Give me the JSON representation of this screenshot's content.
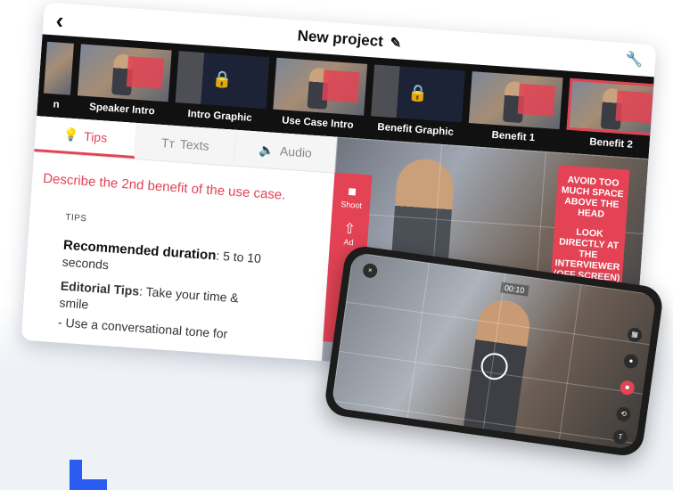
{
  "app": {
    "title": "New project",
    "back_icon": "chevron-left-icon",
    "edit_icon": "pencil-icon",
    "settings_icon": "wrench-icon"
  },
  "strip": {
    "items": [
      {
        "label": "n",
        "type": "video"
      },
      {
        "label": "Speaker Intro",
        "type": "video"
      },
      {
        "label": "Intro Graphic",
        "type": "graphic"
      },
      {
        "label": "Use Case Intro",
        "type": "video"
      },
      {
        "label": "Benefit Graphic",
        "type": "graphic"
      },
      {
        "label": "Benefit 1",
        "type": "video"
      },
      {
        "label": "Benefit 2",
        "type": "video",
        "active": true
      }
    ]
  },
  "tabs": [
    {
      "label": "Tips",
      "active": true
    },
    {
      "label": "Texts"
    },
    {
      "label": "Audio"
    }
  ],
  "panel": {
    "description": "Describe the 2nd benefit of the use case.",
    "tips_heading": "TIPS",
    "duration_label": "Recommended duration",
    "duration_value": ": 5 to 10 seconds",
    "editorial_label": "Editorial Tips",
    "editorial_value": ": Take your time & smile",
    "extra_tip": "- Use a conversational tone for"
  },
  "preview": {
    "shoot_label": "Shoot",
    "add_label": "Ad",
    "card_text_1": "AVOID TOO MUCH SPACE ABOVE THE HEAD",
    "card_text_2": "LOOK DIRECTLY AT THE INTERVIEWER (OFF SCREEN)"
  },
  "phone": {
    "timer": "00:10"
  },
  "colors": {
    "accent": "#e34354",
    "brand_blue": "#2b5cf0"
  }
}
